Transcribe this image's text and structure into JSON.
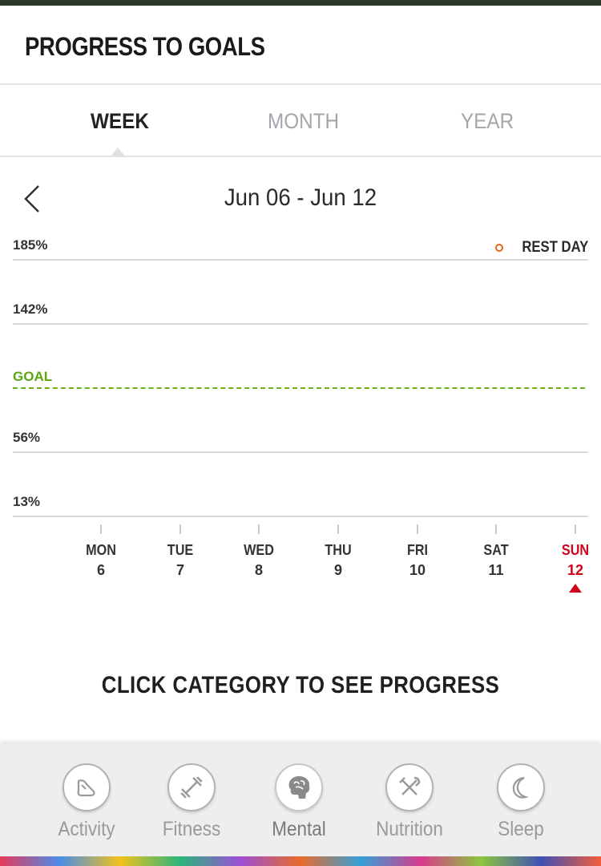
{
  "header": {
    "title": "PROGRESS TO GOALS"
  },
  "tabs": [
    {
      "label": "WEEK",
      "active": true
    },
    {
      "label": "MONTH",
      "active": false
    },
    {
      "label": "YEAR",
      "active": false
    }
  ],
  "date_nav": {
    "range": "Jun 06 - Jun 12",
    "prev_icon": "chevron-left-icon"
  },
  "legend": {
    "label": "REST DAY",
    "color": "#e0651b"
  },
  "chart_data": {
    "type": "line",
    "y_labels": [
      "185%",
      "142%",
      "56%",
      "13%"
    ],
    "goal_label": "GOAL",
    "goal_color": "#6cb31b",
    "days": [
      {
        "name": "MON",
        "date": "6"
      },
      {
        "name": "TUE",
        "date": "7"
      },
      {
        "name": "WED",
        "date": "8"
      },
      {
        "name": "THU",
        "date": "9"
      },
      {
        "name": "FRI",
        "date": "10"
      },
      {
        "name": "SAT",
        "date": "11"
      },
      {
        "name": "SUN",
        "date": "12",
        "today": true
      }
    ],
    "series": [],
    "today_color": "#d0021b"
  },
  "cta": "CLICK CATEGORY TO SEE PROGRESS",
  "categories": [
    {
      "label": "Activity",
      "icon": "shoe-icon"
    },
    {
      "label": "Fitness",
      "icon": "dumbbell-icon"
    },
    {
      "label": "Mental",
      "icon": "brain-icon",
      "active": true
    },
    {
      "label": "Nutrition",
      "icon": "fork-knife-icon"
    },
    {
      "label": "Sleep",
      "icon": "moon-icon"
    }
  ]
}
